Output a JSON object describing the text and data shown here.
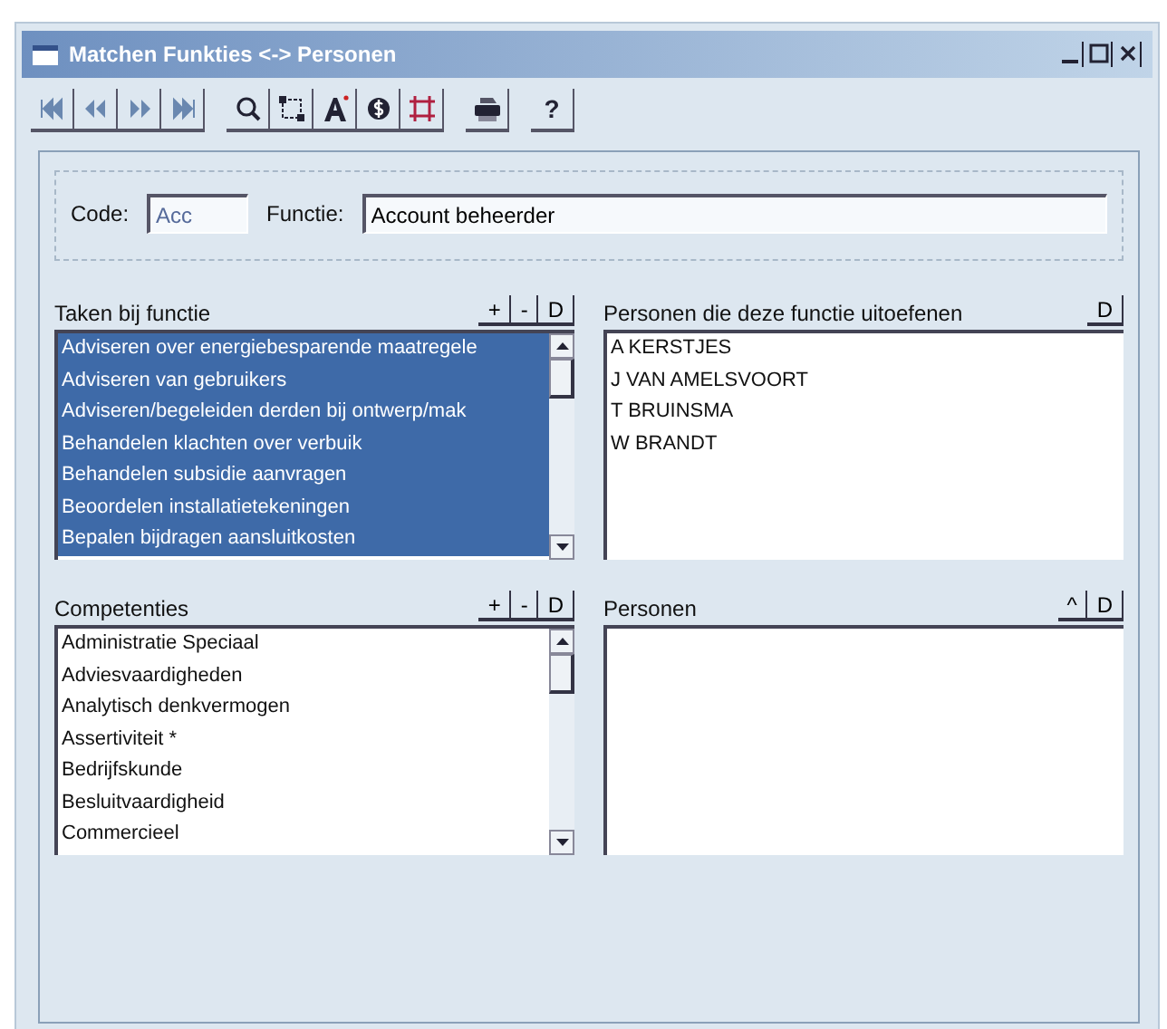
{
  "window": {
    "title": "Matchen Funkties <-> Personen",
    "controls": [
      {
        "kind": "minimize"
      },
      {
        "kind": "maximize"
      },
      {
        "kind": "close"
      }
    ]
  },
  "toolbar": [
    {
      "kind": "first"
    },
    {
      "kind": "prev"
    },
    {
      "kind": "next"
    },
    {
      "kind": "last"
    },
    {
      "kind": "search"
    },
    {
      "kind": "frame"
    },
    {
      "kind": "font"
    },
    {
      "kind": "dollar"
    },
    {
      "kind": "crop"
    },
    {
      "kind": "print"
    },
    {
      "kind": "help",
      "label": "?"
    }
  ],
  "code": {
    "label": "Code:",
    "value": "Acc"
  },
  "functie": {
    "label": "Functie:",
    "value": "Account beheerder"
  },
  "taken": {
    "title": "Taken bij functie",
    "buttons": [
      "+",
      "-",
      "D"
    ],
    "items": [
      {
        "text": "Adviseren over energiebesparende maatregele",
        "selected": true
      },
      {
        "text": "Adviseren van gebruikers",
        "selected": true
      },
      {
        "text": "Adviseren/begeleiden derden bij ontwerp/mak",
        "selected": true
      },
      {
        "text": "Behandelen klachten over verbuik",
        "selected": true
      },
      {
        "text": "Behandelen subsidie aanvragen",
        "selected": true
      },
      {
        "text": "Beoordelen installatietekeningen",
        "selected": true
      },
      {
        "text": "Bepalen bijdragen aansluitkosten",
        "selected": true
      }
    ]
  },
  "personen_functie": {
    "title": "Personen die deze functie uitoefenen",
    "buttons": [
      "D"
    ],
    "items": [
      {
        "text": "A KERSTJES",
        "selected": false
      },
      {
        "text": "J VAN AMELSVOORT",
        "selected": false
      },
      {
        "text": "T BRUINSMA",
        "selected": false
      },
      {
        "text": "W BRANDT",
        "selected": false
      }
    ]
  },
  "competenties": {
    "title": "Competenties",
    "buttons": [
      "+",
      "-",
      "D"
    ],
    "items": [
      {
        "text": "Administratie Speciaal",
        "selected": false
      },
      {
        "text": "Adviesvaardigheden",
        "selected": false
      },
      {
        "text": "Analytisch denkvermogen",
        "selected": false
      },
      {
        "text": "Assertiviteit *",
        "selected": false
      },
      {
        "text": "Bedrijfskunde",
        "selected": false
      },
      {
        "text": "Besluitvaardigheid",
        "selected": false
      },
      {
        "text": "Commercieel",
        "selected": false
      }
    ]
  },
  "personen": {
    "title": "Personen",
    "buttons": [
      "^",
      "D"
    ]
  }
}
